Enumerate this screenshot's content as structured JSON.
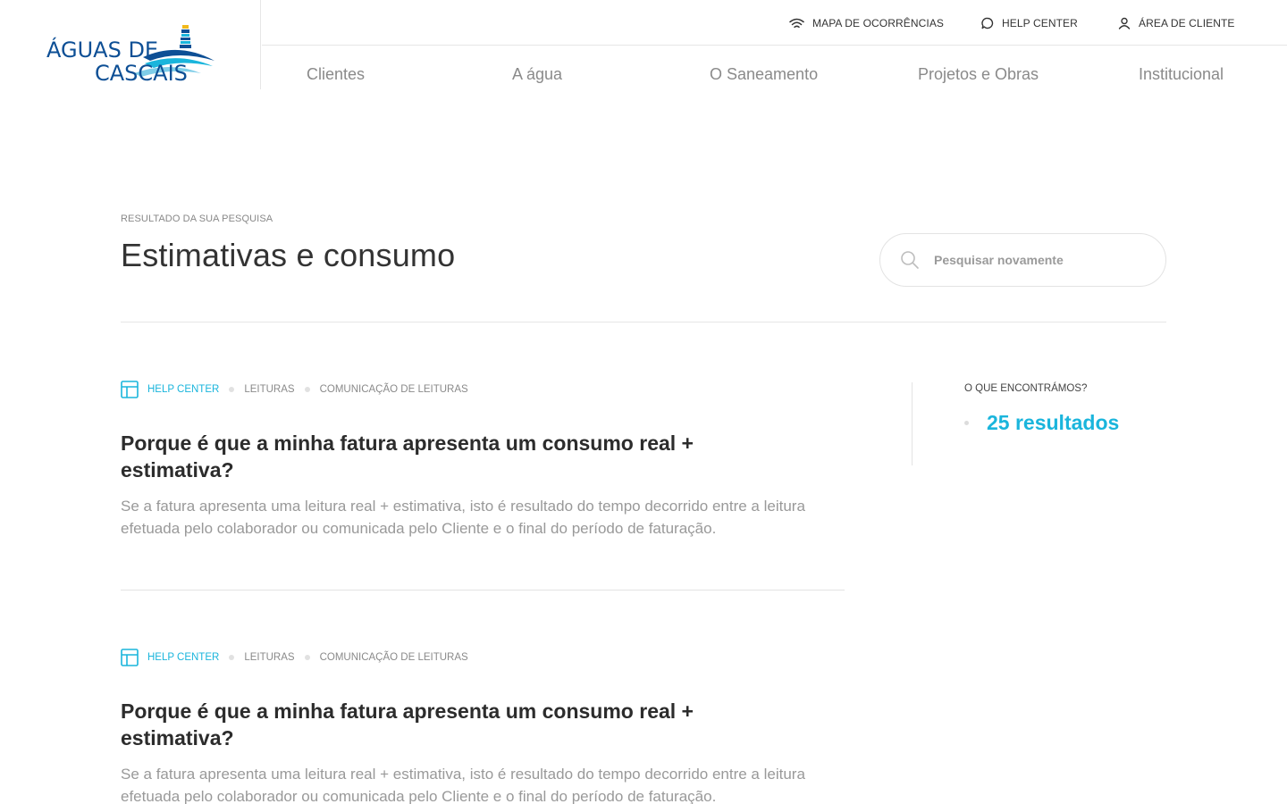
{
  "header": {
    "logo": {
      "line1": "ÁGUAS DE",
      "line2": "CASCAIS"
    },
    "top_links": [
      {
        "label": "MAPA DE OCORRÊNCIAS",
        "icon": "wifi-signal-icon"
      },
      {
        "label": "HELP CENTER",
        "icon": "chat-bubble-icon"
      },
      {
        "label": "ÁREA DE CLIENTE",
        "icon": "user-icon"
      }
    ],
    "nav": [
      "Clientes",
      "A água",
      "O Saneamento",
      "Projetos e Obras",
      "Institucional"
    ]
  },
  "search": {
    "eyebrow": "RESULTADO DA SUA PESQUISA",
    "query": "Estimativas e consumo",
    "placeholder": "Pesquisar novamente",
    "icon": "search-icon"
  },
  "results": [
    {
      "breadcrumb": [
        "HELP CENTER",
        "LEITURAS",
        "COMUNICAÇÃO DE LEITURAS"
      ],
      "title": "Porque é que a minha fatura apresenta um consumo real + estimativa?",
      "snippet": "Se a fatura apresenta uma leitura real + estimativa, isto é resultado do tempo decorrido entre a leitura efetuada pelo colaborador ou comunicada pelo Cliente e o final do período de faturação."
    },
    {
      "breadcrumb": [
        "HELP CENTER",
        "LEITURAS",
        "COMUNICAÇÃO DE LEITURAS"
      ],
      "title": "Porque é que a minha fatura apresenta um consumo real + estimativa?",
      "snippet": "Se a fatura apresenta uma leitura real + estimativa, isto é resultado do tempo decorrido entre a leitura efetuada pelo colaborador ou comunicada pelo Cliente e o final do período de faturação."
    }
  ],
  "sidebar": {
    "label": "O QUE ENCONTRÁMOS?",
    "count": "25 resultados"
  },
  "colors": {
    "accent": "#1ab5dc",
    "logo_blue": "#0d4f95"
  }
}
